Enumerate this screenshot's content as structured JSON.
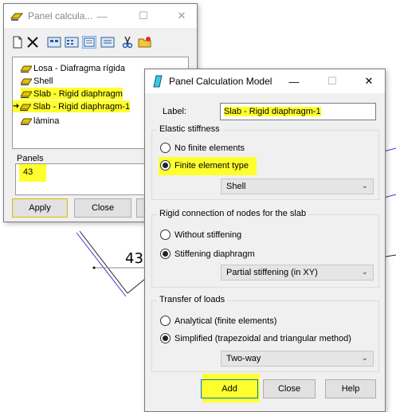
{
  "background": {
    "node_label": "43"
  },
  "panel_window": {
    "title": "Panel calcula...",
    "list_items": [
      {
        "label": "Losa - Diafragma rígida",
        "selected": false
      },
      {
        "label": "Shell",
        "selected": false
      },
      {
        "label": "Slab - Rigid diaphragm",
        "selected": false
      },
      {
        "label": "Slab - Rigid diaphragm-1",
        "selected": true
      },
      {
        "label": "lámina",
        "selected": false
      }
    ],
    "panels_label": "Panels",
    "panels_value": "43",
    "apply_label": "Apply",
    "close_label": "Close"
  },
  "dialog": {
    "title": "Panel Calculation Model",
    "label_caption": "Label:",
    "label_value": "Slab - Rigid diaphragm-1",
    "elastic": {
      "title": "Elastic stiffness",
      "option_none": "No finite elements",
      "option_fe": "Finite element type",
      "fe_type": "Shell"
    },
    "rigid": {
      "title": "Rigid connection of nodes for the slab",
      "option_without": "Without stiffening",
      "option_diaphragm": "Stiffening diaphragm",
      "stiffening_type": "Partial stiffening (in XY)"
    },
    "transfer": {
      "title": "Transfer of loads",
      "option_analytical": "Analytical (finite elements)",
      "option_simplified": "Simplified (trapezoidal and triangular method)",
      "direction": "Two-way"
    },
    "add_label": "Add",
    "close_label": "Close",
    "help_label": "Help"
  },
  "colors": {
    "highlight": "#ffff2e",
    "accent": "#0078d7"
  }
}
